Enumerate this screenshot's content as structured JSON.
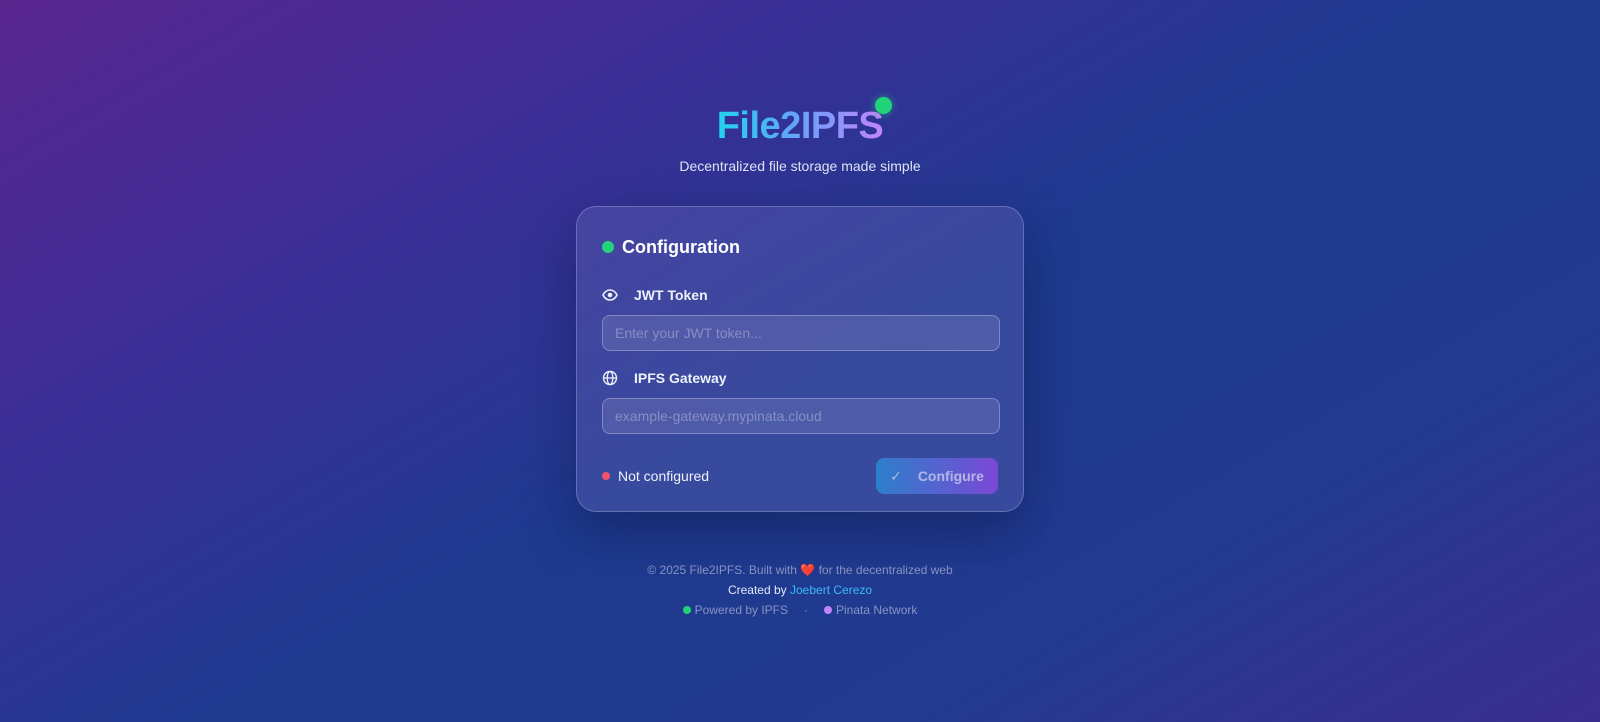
{
  "brand": {
    "logo": "File2IPFS",
    "tagline": "Decentralized file storage made simple",
    "colors": {
      "accent_green": "#22d37a",
      "gradient_start": "#22d3ee",
      "gradient_end": "#c084fc"
    }
  },
  "config_card": {
    "title": "Configuration",
    "jwt": {
      "label": "JWT Token",
      "icon": "eye-icon",
      "placeholder": "Enter your JWT token...",
      "value": ""
    },
    "gateway": {
      "label": "IPFS Gateway",
      "icon": "globe-icon",
      "placeholder": "example-gateway.mypinata.cloud",
      "value": ""
    },
    "status": {
      "text": "Not configured",
      "color": "#f0536c"
    },
    "configure_button": {
      "label": "Configure",
      "icon": "check-icon"
    }
  },
  "footer": {
    "copyright_prefix": "© 2025 File2IPFS. Built with",
    "heart": "❤️",
    "copyright_suffix": "for the decentralized web",
    "created_by_prefix": "Created by",
    "author": "Joebert Cerezo",
    "powered_by": "Powered by IPFS",
    "separator": "·",
    "network": "Pinata Network"
  }
}
